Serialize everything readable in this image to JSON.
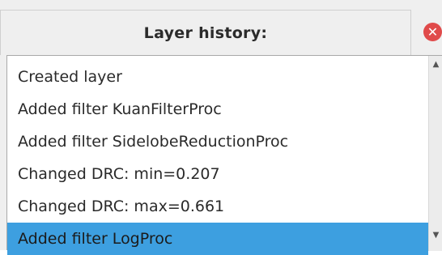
{
  "panel": {
    "title": "Layer history:",
    "close_icon": "close-icon",
    "close_color": "#e04a4a"
  },
  "history": {
    "items": [
      {
        "label": "Created layer",
        "selected": false
      },
      {
        "label": "Added filter KuanFilterProc",
        "selected": false
      },
      {
        "label": "Added filter SidelobeReductionProc",
        "selected": false
      },
      {
        "label": "Changed DRC: min=0.207",
        "selected": false
      },
      {
        "label": "Changed DRC: max=0.661",
        "selected": false
      },
      {
        "label": "Added filter LogProc",
        "selected": true
      }
    ],
    "selection_color": "#3d9fe0"
  },
  "scrollbar": {
    "up_icon": "scroll-up-arrow-icon",
    "down_icon": "scroll-down-arrow-icon"
  }
}
